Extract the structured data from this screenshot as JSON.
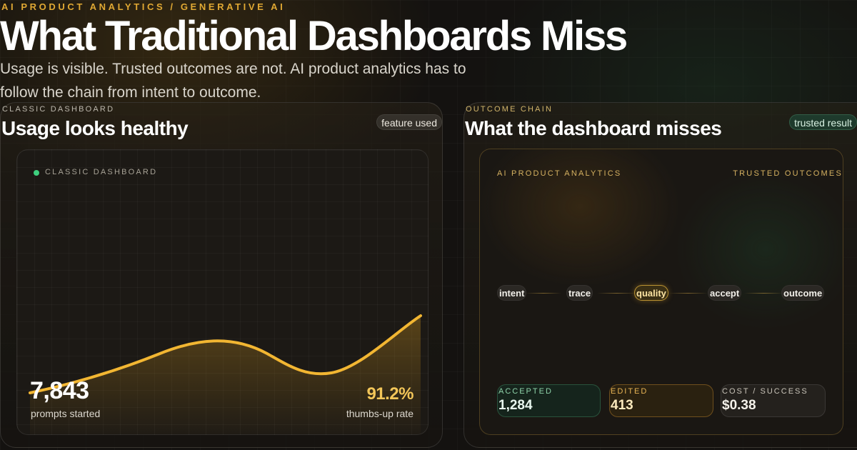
{
  "header": {
    "eyebrow": "AI PRODUCT ANALYTICS / GENERATIVE AI",
    "title": "What Traditional Dashboards Miss",
    "subtitle": "Usage is visible. Trusted outcomes are not. AI product analytics has to follow the chain from intent to outcome."
  },
  "left_panel": {
    "kicker": "CLASSIC DASHBOARD",
    "title": "Usage looks healthy",
    "chip": "feature used",
    "inner_kicker": "CLASSIC DASHBOARD",
    "stat_primary": {
      "value": "7,843",
      "label": "prompts started"
    },
    "stat_secondary": {
      "value": "91.2%",
      "label": "thumbs-up rate"
    },
    "line_color": "#f2b632",
    "dot_color": "#3ecf7e"
  },
  "right_panel": {
    "kicker": "OUTCOME CHAIN",
    "title": "What the dashboard misses",
    "chip": "trusted result",
    "left_label": "AI PRODUCT ANALYTICS",
    "right_label": "TRUSTED OUTCOMES",
    "chain": [
      "intent",
      "trace",
      "quality",
      "accept",
      "outcome"
    ],
    "highlighted_step": "quality",
    "cards": {
      "accepted": {
        "label": "ACCEPTED",
        "value": "1,284"
      },
      "edited": {
        "label": "EDITED",
        "value": "413"
      },
      "cost": {
        "label": "COST / SUCCESS",
        "value": "$0.38"
      }
    }
  },
  "colors": {
    "accent_gold": "#e0a833",
    "accent_green": "#3ecf7e",
    "background": "#141210"
  }
}
